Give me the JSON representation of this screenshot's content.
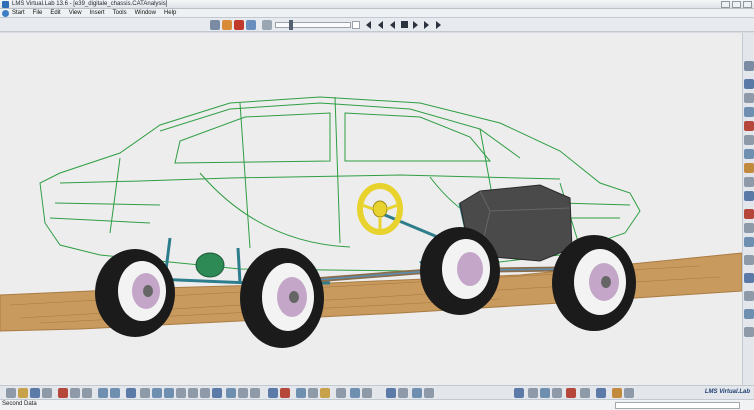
{
  "window": {
    "title": "LMS Virtual.Lab 13.6 - [e39_digitale_chassis.CATAnalysis]"
  },
  "menu": {
    "items": [
      "Start",
      "File",
      "Edit",
      "View",
      "Insert",
      "Tools",
      "Window",
      "Help"
    ]
  },
  "toolbar": {
    "icons": [
      "analysis-icon",
      "material-icon",
      "sensor-icon",
      "render-icon",
      "slider-icon"
    ],
    "player_controls": [
      "skip-start-icon",
      "step-back-icon",
      "play-back-icon",
      "stop-icon",
      "play-icon",
      "step-forward-icon",
      "skip-end-icon"
    ]
  },
  "viewport": {
    "content": "3D multibody model of a car chassis driving on a terrain road",
    "colors": {
      "background": "#ededed",
      "body_wireframe": "#2f9e44",
      "road": "#c99a5e",
      "steering_wheel": "#e8d32e",
      "tires": "#1b1b1b",
      "engine_block": "#4a4a4a",
      "suspension": "#2e7d8c"
    }
  },
  "bottom_toolbar": {
    "brand": "LMS Virtual.Lab"
  },
  "status": {
    "text": "Second Data"
  }
}
